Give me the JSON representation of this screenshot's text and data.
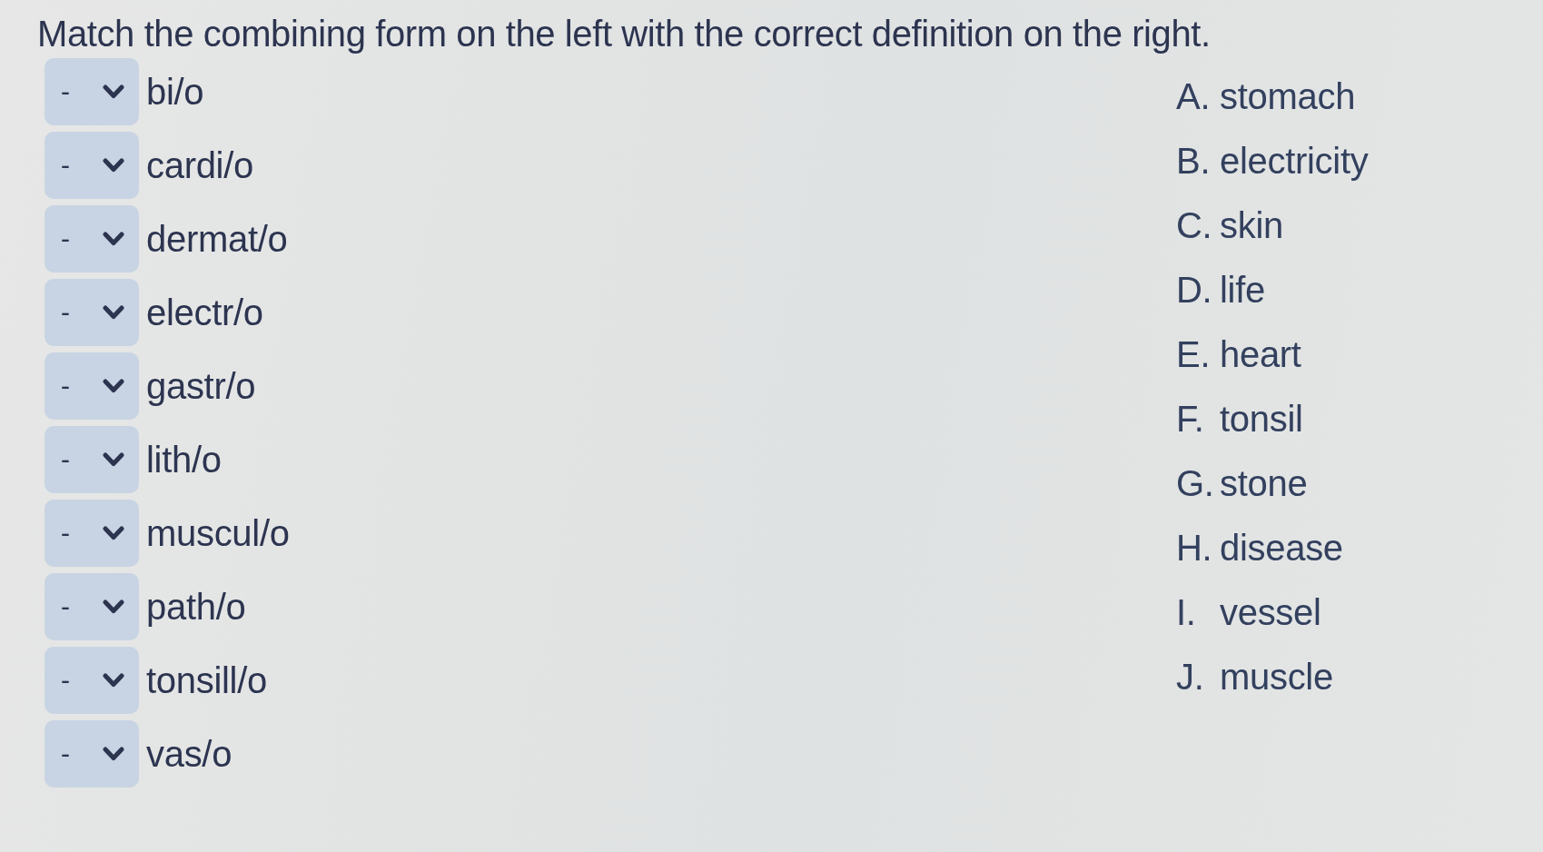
{
  "instruction": "Match the combining form on the left with the correct definition on the right.",
  "combining_forms": [
    {
      "dropdown_value": "-",
      "term": "bi/o"
    },
    {
      "dropdown_value": "-",
      "term": "cardi/o"
    },
    {
      "dropdown_value": "-",
      "term": "dermat/o"
    },
    {
      "dropdown_value": "-",
      "term": "electr/o"
    },
    {
      "dropdown_value": "-",
      "term": "gastr/o"
    },
    {
      "dropdown_value": "-",
      "term": "lith/o"
    },
    {
      "dropdown_value": "-",
      "term": "muscul/o"
    },
    {
      "dropdown_value": "-",
      "term": "path/o"
    },
    {
      "dropdown_value": "-",
      "term": "tonsill/o"
    },
    {
      "dropdown_value": "-",
      "term": "vas/o"
    }
  ],
  "definitions": [
    {
      "letter": "A.",
      "text": "stomach"
    },
    {
      "letter": "B.",
      "text": "electricity"
    },
    {
      "letter": "C.",
      "text": "skin"
    },
    {
      "letter": "D.",
      "text": "life"
    },
    {
      "letter": "E.",
      "text": "heart"
    },
    {
      "letter": "F.",
      "text": "tonsil"
    },
    {
      "letter": "G.",
      "text": "stone"
    },
    {
      "letter": "H.",
      "text": "disease"
    },
    {
      "letter": "I.",
      "text": "vessel"
    },
    {
      "letter": "J.",
      "text": "muscle"
    }
  ]
}
